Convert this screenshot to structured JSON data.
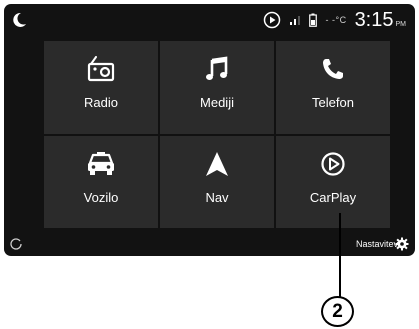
{
  "status_bar": {
    "temperature": "- -°C",
    "time": "3:15",
    "ampm": "PM"
  },
  "tiles": [
    {
      "label": "Radio",
      "icon": "radio-icon"
    },
    {
      "label": "Mediji",
      "icon": "music-note-icon"
    },
    {
      "label": "Telefon",
      "icon": "phone-icon"
    },
    {
      "label": "Vozilo",
      "icon": "car-icon"
    },
    {
      "label": "Nav",
      "icon": "navigation-arrow-icon"
    },
    {
      "label": "CarPlay",
      "icon": "carplay-icon"
    }
  ],
  "settings": {
    "label": "Nastavitev"
  },
  "callout": {
    "number": "2"
  }
}
